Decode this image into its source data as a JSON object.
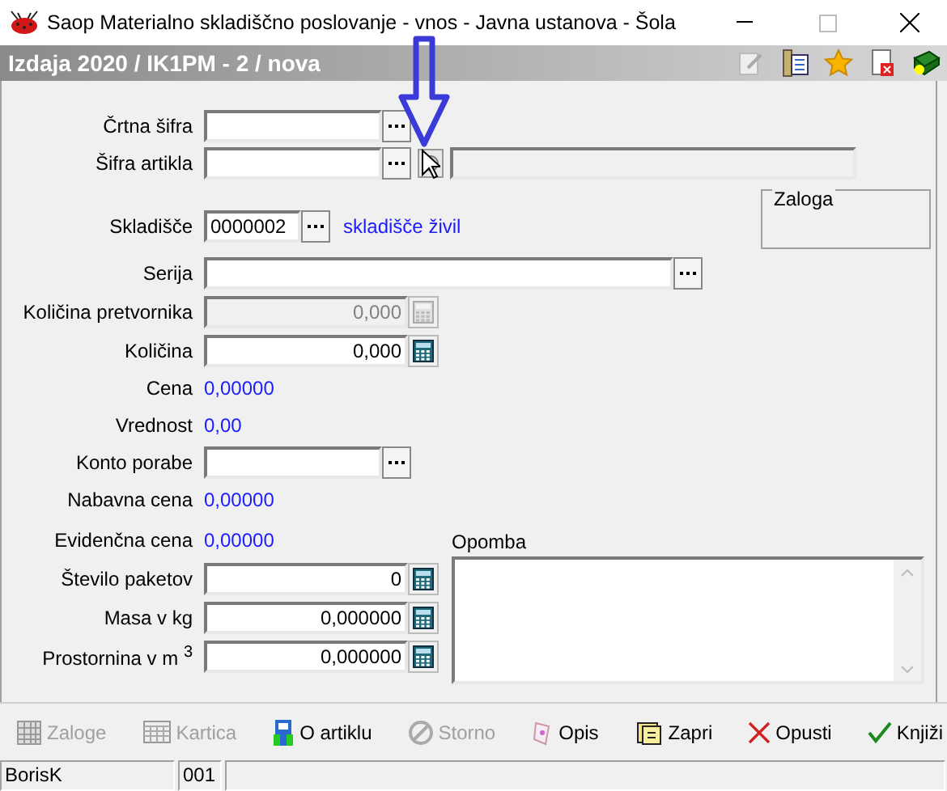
{
  "window": {
    "title": "Saop Materialno skladiščno poslovanje - vnos - Javna ustanova - Šola"
  },
  "header": {
    "title": "Izdaja 2020 / IK1PM - 2 / nova"
  },
  "fields": [
    {
      "kind": "lookup",
      "label": "Črtna šifra"
    },
    {
      "kind": "lookup_detail",
      "label": "Šifra artikla"
    },
    {
      "kind": "lookup_link",
      "label": "Skladišče",
      "value": "0000002",
      "link": "skladišče živil"
    },
    {
      "kind": "wide_lookup",
      "label": "Serija"
    },
    {
      "kind": "calc",
      "label": "Količina pretvornika",
      "value": "0,000",
      "disabled": true
    },
    {
      "kind": "calc",
      "label": "Količina",
      "value": "0,000",
      "disabled": false
    },
    {
      "kind": "readout",
      "label": "Cena",
      "value": "0,00000"
    },
    {
      "kind": "readout",
      "label": "Vrednost",
      "value": "0,00"
    },
    {
      "kind": "lookup",
      "label": "Konto porabe"
    },
    {
      "kind": "readout",
      "label": "Nabavna cena",
      "value": "0,00000"
    }
  ],
  "stock_group": {
    "title": "Zaloga"
  },
  "lower_fields": [
    {
      "kind": "readout",
      "label": "Evidenčna cena",
      "value": "0,00000"
    },
    {
      "kind": "calc",
      "label": "Število paketov",
      "value": "0",
      "disabled": false
    },
    {
      "kind": "calc",
      "label": "Masa v kg",
      "value": "0,000000",
      "disabled": false
    },
    {
      "kind": "calc",
      "label": "Prostornina v m $^{3}$",
      "value": "0,000000",
      "disabled": false
    }
  ],
  "note": {
    "label": "Opomba"
  },
  "toolbar": {
    "left": [
      {
        "kind": "grid",
        "label": "Zaloge",
        "disabled": true
      },
      {
        "kind": "card",
        "label": "Kartica",
        "disabled": true
      },
      {
        "kind": "info",
        "label": "O artiklu",
        "disabled": false
      },
      {
        "kind": "cancel",
        "label": "Storno",
        "disabled": true
      },
      {
        "kind": "text",
        "label": "Opis",
        "disabled": false
      }
    ],
    "right": [
      {
        "kind": "close",
        "label": "Zapri",
        "disabled": false
      },
      {
        "kind": "discard",
        "label": "Opusti",
        "disabled": false
      },
      {
        "kind": "confirm",
        "label": "Knjiži",
        "disabled": false
      }
    ]
  },
  "status_bar": {
    "user": "BorisK",
    "code": "001"
  }
}
